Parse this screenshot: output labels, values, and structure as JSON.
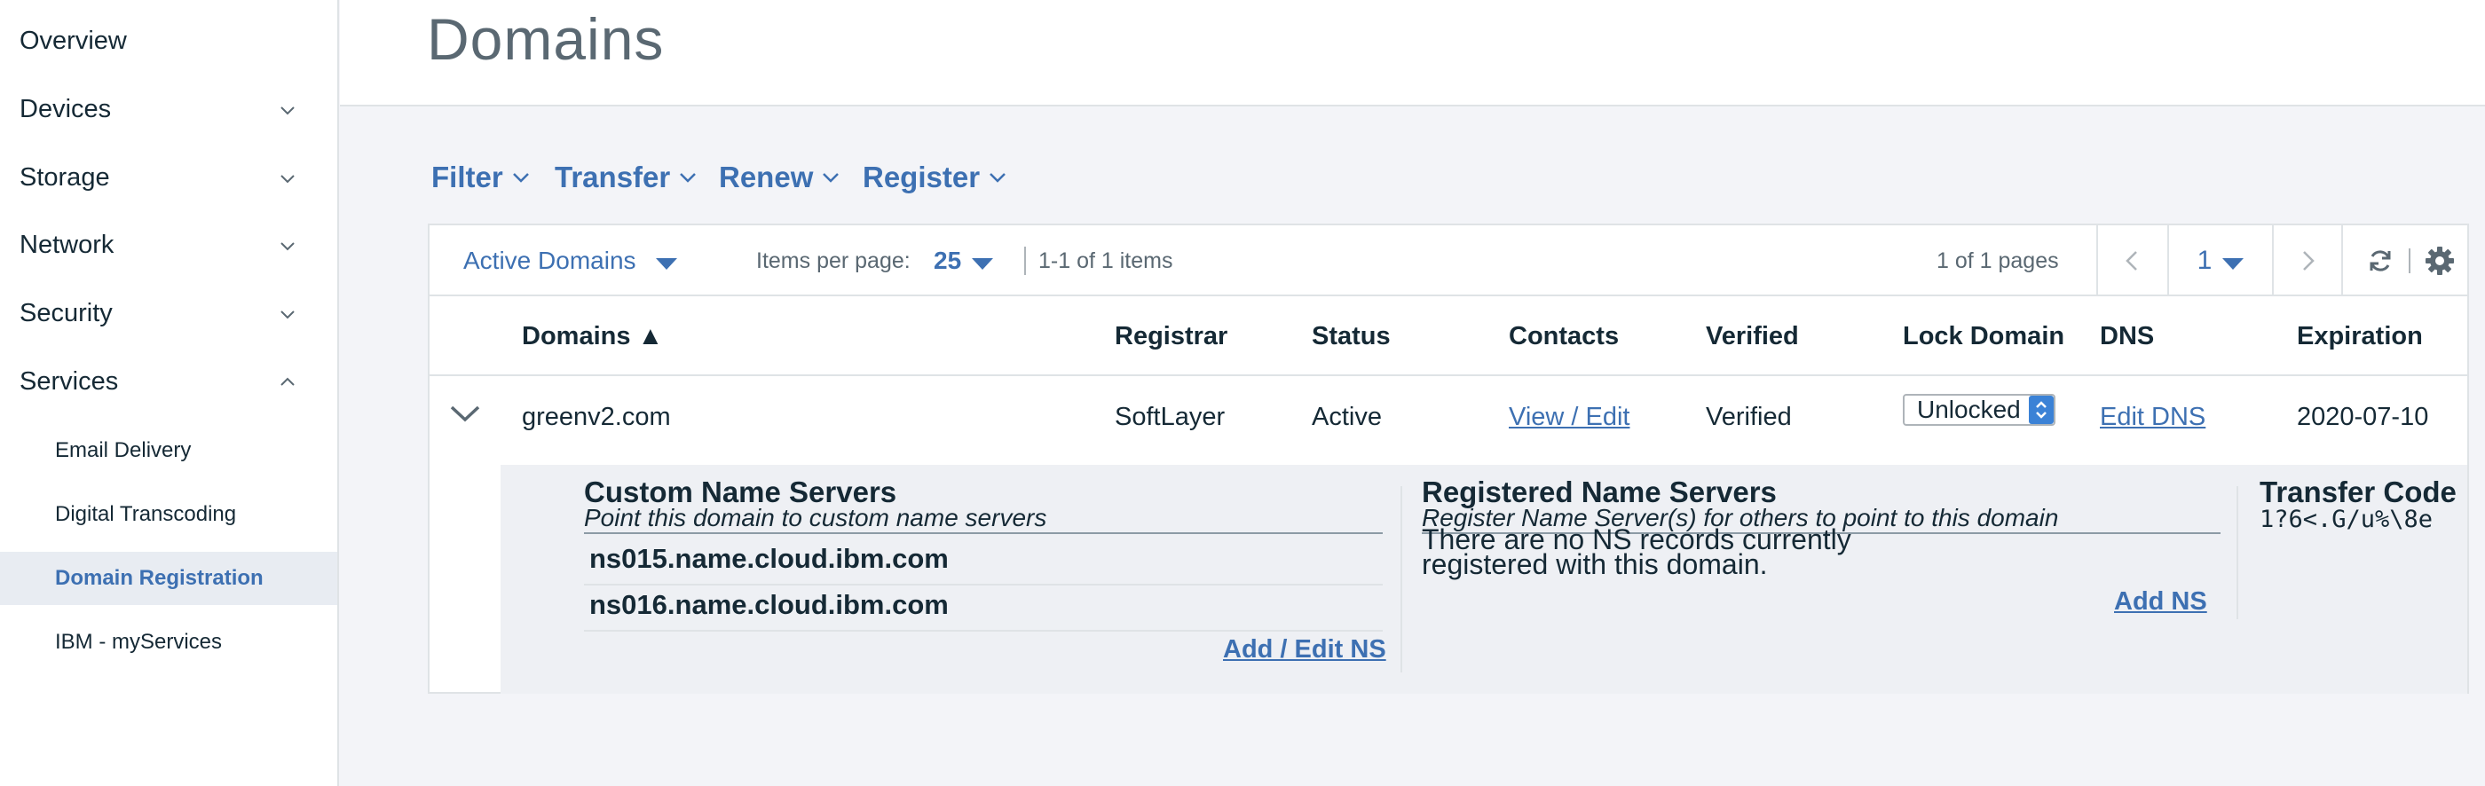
{
  "sidebar": {
    "items": [
      {
        "label": "Overview"
      },
      {
        "label": "Devices"
      },
      {
        "label": "Storage"
      },
      {
        "label": "Network"
      },
      {
        "label": "Security"
      },
      {
        "label": "Services"
      }
    ],
    "sub_items": [
      {
        "label": "Email Delivery"
      },
      {
        "label": "Digital Transcoding"
      },
      {
        "label": "Domain Registration"
      },
      {
        "label": "IBM - myServices"
      }
    ]
  },
  "header": {
    "title": "Domains"
  },
  "actions": {
    "filter": "Filter",
    "transfer": "Transfer",
    "renew": "Renew",
    "register": "Register"
  },
  "toolbar": {
    "view_select": "Active Domains",
    "items_per_page_label": "Items per page:",
    "items_per_page_value": "25",
    "range_text": "1-1 of 1 items",
    "pages_text": "1 of 1 pages",
    "page_value": "1"
  },
  "table": {
    "headers": {
      "domains": "Domains ▲",
      "registrar": "Registrar",
      "status": "Status",
      "contacts": "Contacts",
      "verified": "Verified",
      "lock": "Lock Domain",
      "dns": "DNS",
      "expiration": "Expiration"
    },
    "row": {
      "domain": "greenv2.com",
      "registrar": "SoftLayer",
      "status": "Active",
      "contacts": "View / Edit",
      "verified": "Verified",
      "lock": "Unlocked",
      "dns": "Edit DNS",
      "expiration": "2020-07-10"
    }
  },
  "detail": {
    "custom_ns": {
      "title": "Custom Name Servers",
      "subtitle": "Point this domain to custom name servers",
      "servers": [
        "ns015.name.cloud.ibm.com",
        "ns016.name.cloud.ibm.com"
      ],
      "action": "Add / Edit NS"
    },
    "registered_ns": {
      "title": "Registered Name Servers",
      "subtitle": "Register Name Server(s) for others to point to this domain",
      "empty_line1": "There are no NS records currently",
      "empty_line2": "registered with this domain.",
      "action": "Add NS"
    },
    "transfer": {
      "title": "Transfer Code",
      "code": "1?6<.G/u%\\8e"
    }
  },
  "colors": {
    "accent": "#3d70b2",
    "text": "#152935",
    "muted": "#5a6872",
    "border": "#dfe3e6"
  }
}
